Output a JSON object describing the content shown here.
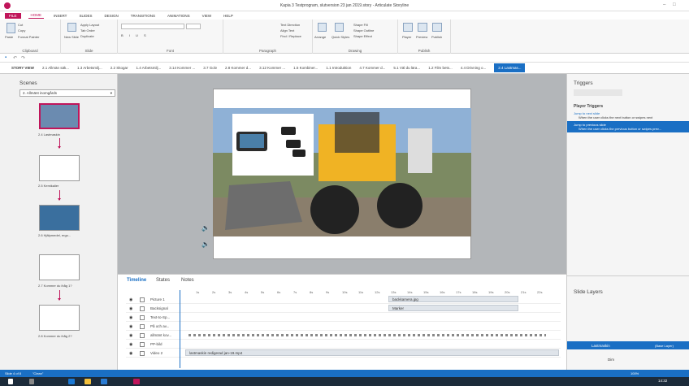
{
  "window": {
    "title": "Kapia 3 Testprogram, slutversion 23 jan 2019.story - Articulate Storyline"
  },
  "ribbon_tabs": [
    "FILE",
    "HOME",
    "INSERT",
    "SLIDES",
    "DESIGN",
    "TRANSITIONS",
    "ANIMATIONS",
    "VIEW",
    "HELP"
  ],
  "ribbon": {
    "cut": "Cut",
    "copy": "Copy",
    "paste": "Paste",
    "format_painter": "Format Painter",
    "new_slide": "New Slide",
    "apply_layout": "Apply Layout",
    "tab_order": "Tab Order",
    "duplicate": "Duplicate",
    "text_direction": "Text Direction",
    "align_text": "Align Text",
    "find_replace": "Find / Replace",
    "arrange": "Arrange",
    "quick_styles": "Quick Styles",
    "shape_fill": "Shape Fill",
    "shape_outline": "Shape Outline",
    "shape_effect": "Shape Effect",
    "player": "Player",
    "preview": "Preview",
    "publish": "Publish",
    "groups": [
      "Clipboard",
      "Slide",
      "Font",
      "Paragraph",
      "Drawing",
      "Publish"
    ]
  },
  "story_view": "STORY VIEW",
  "story_tabs": [
    "2.1 Allmän säk...",
    "1.3 Arbetsmilj...",
    "2.2 Skogar",
    "1.4 Arbetsmilj...",
    "3.14 Kommer ...",
    "3.7 Golv",
    "2.8 Kommer d...",
    "3.12 Kommer ...",
    "1.5 Kombiner...",
    "1.1 Introduktion",
    "4.7 Kommer d...",
    "5.1 Väl du lära...",
    "1.2 Film bets...",
    "4.4 Drivning o..."
  ],
  "active_story_tab": "2.4 Lastmas...",
  "scenes": {
    "title": "Scenes",
    "selected_scene": "2. Allmänt inomgårds",
    "slides": [
      "2.4 Lastmaskin",
      "2.5 Kemikalier",
      "2.6 Hjälpmedel, ergo...",
      "2.7 Kommer du ihåg 1?",
      "2.8 Kommer du ihåg 2?"
    ]
  },
  "timeline": {
    "tabs": [
      "Timeline",
      "States",
      "Notes"
    ],
    "ticks": [
      "1s",
      "2s",
      "3s",
      "4s",
      "5s",
      "6s",
      "7s",
      "8s",
      "9s",
      "10s",
      "11s",
      "12s",
      "13s",
      "14s",
      "15s",
      "16s",
      "17s",
      "18s",
      "19s",
      "20s",
      "21s",
      "22s"
    ],
    "rows": [
      "Picture 1",
      "Backsignal",
      "Text-to-Sp...",
      "På och av...",
      "allmänt kov...",
      "PP-bild",
      "Video 2"
    ],
    "bars": {
      "backkamera": "backkamera.jpg",
      "marker": "Marker",
      "video": "lastmaskin redigerad jan-19.mp4"
    }
  },
  "triggers": {
    "title": "Triggers",
    "player_triggers": "Player Triggers",
    "t1_a": "Jump to next slide",
    "t1_b": "When the user clicks the next button or swipes next",
    "t2_a": "Jump to previous slide",
    "t2_b": "When the user clicks the previous button or swipes prev..."
  },
  "layers": {
    "title": "Slide Layers",
    "base_name": "Lastmaskin",
    "base_tag": "(Base Layer)",
    "dim": "Dim"
  },
  "status": {
    "slide": "Slide 4 of 8",
    "clean": "\"Clean\"",
    "zoom": "100%"
  },
  "clock": {
    "time": "14:32"
  }
}
